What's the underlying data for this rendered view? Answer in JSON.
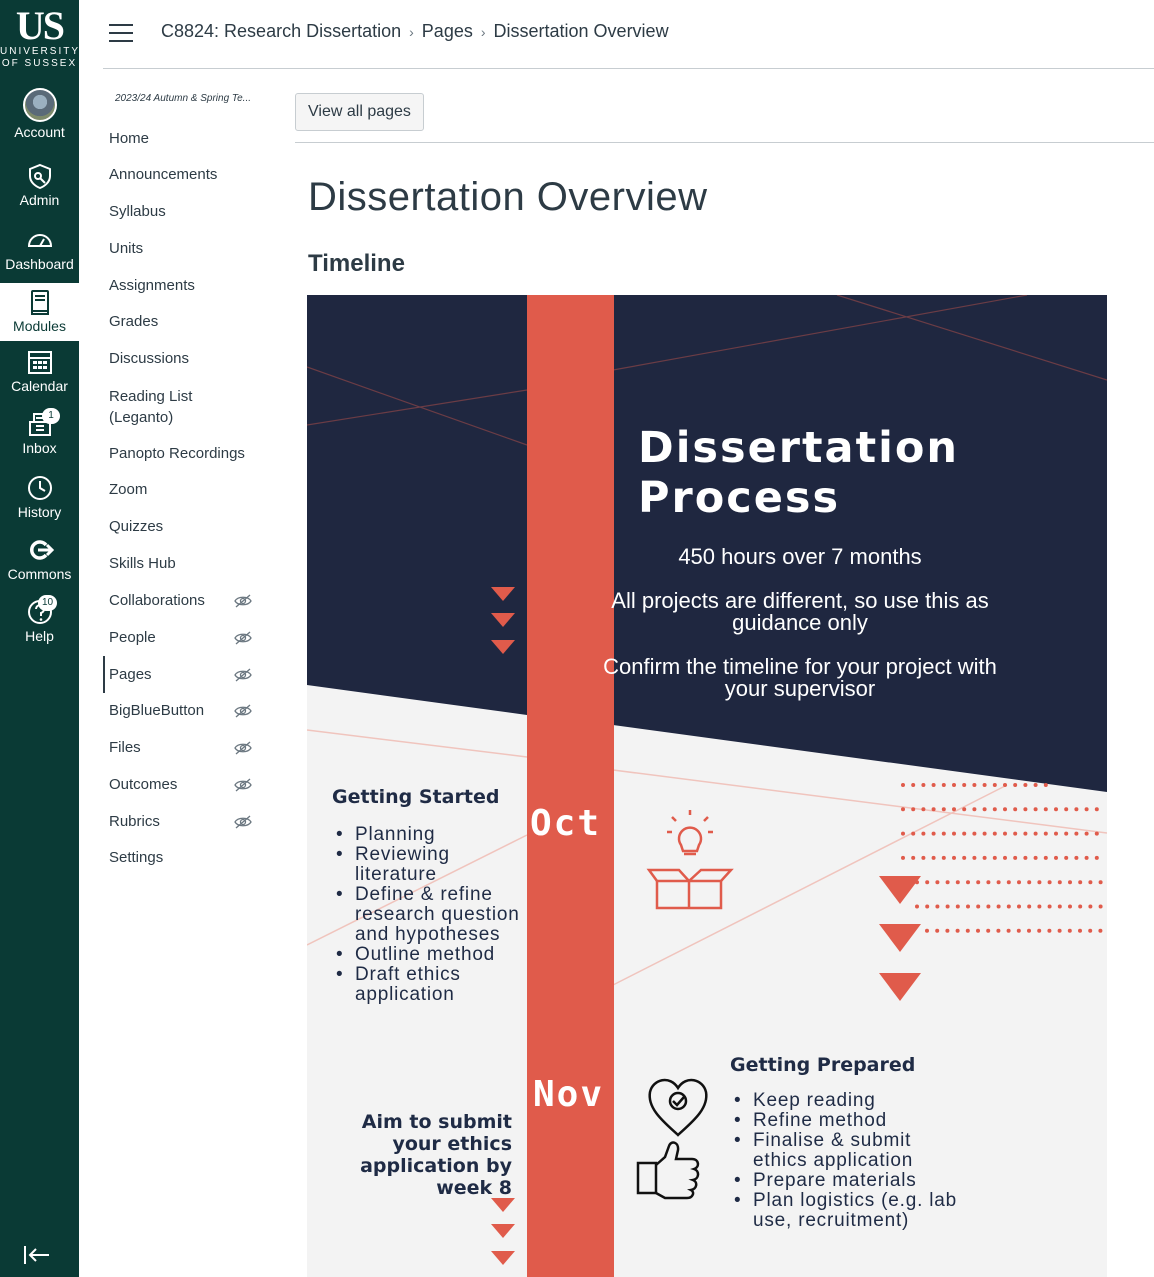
{
  "global_nav": {
    "logo": {
      "line1": "US",
      "line2": "UNIVERSITY",
      "line3": "OF SUSSEX"
    },
    "items": [
      {
        "label": "Account",
        "icon": "avatar"
      },
      {
        "label": "Admin",
        "icon": "shield-icon"
      },
      {
        "label": "Dashboard",
        "icon": "dashboard-icon"
      },
      {
        "label": "Modules",
        "icon": "book-icon"
      },
      {
        "label": "Calendar",
        "icon": "calendar-icon"
      },
      {
        "label": "Inbox",
        "icon": "inbox-icon",
        "badge": "1"
      },
      {
        "label": "History",
        "icon": "clock-icon"
      },
      {
        "label": "Commons",
        "icon": "commons-icon"
      },
      {
        "label": "Help",
        "icon": "help-icon",
        "badge": "10"
      }
    ],
    "collapse_icon": "collapse-nav-icon"
  },
  "header": {
    "breadcrumb": [
      "C8824: Research Dissertation",
      "Pages",
      "Dissertation Overview"
    ]
  },
  "course_nav": {
    "term": "2023/24 Autumn & Spring Te...",
    "items": [
      {
        "label": "Home",
        "hidden": false
      },
      {
        "label": "Announcements",
        "hidden": false
      },
      {
        "label": "Syllabus",
        "hidden": false
      },
      {
        "label": "Units",
        "hidden": false
      },
      {
        "label": "Assignments",
        "hidden": false
      },
      {
        "label": "Grades",
        "hidden": false
      },
      {
        "label": "Discussions",
        "hidden": false
      },
      {
        "label": "Reading List (Leganto)",
        "hidden": false
      },
      {
        "label": "Panopto Recordings",
        "hidden": false
      },
      {
        "label": "Zoom",
        "hidden": false
      },
      {
        "label": "Quizzes",
        "hidden": false
      },
      {
        "label": "Skills Hub",
        "hidden": false
      },
      {
        "label": "Collaborations",
        "hidden": true
      },
      {
        "label": "People",
        "hidden": true
      },
      {
        "label": "Pages",
        "hidden": true,
        "active": true
      },
      {
        "label": "BigBlueButton",
        "hidden": true
      },
      {
        "label": "Files",
        "hidden": true
      },
      {
        "label": "Outcomes",
        "hidden": true
      },
      {
        "label": "Rubrics",
        "hidden": true
      },
      {
        "label": "Settings",
        "hidden": false
      }
    ]
  },
  "content": {
    "view_all_label": "View all pages",
    "page_title": "Dissertation Overview",
    "section_title": "Timeline"
  },
  "infographic": {
    "title_line1": "Dissertation",
    "title_line2": "Process",
    "subtitle1": "450 hours over 7 months",
    "subtitle2": "All projects are different, so use this as guidance only",
    "subtitle3": "Confirm the timeline for your project with your supervisor",
    "month1": "Oct",
    "month2": "Nov",
    "getting_started": {
      "title": "Getting Started",
      "items": [
        "Planning",
        "Reviewing literature",
        "Define & refine research question and hypotheses",
        "Outline method",
        "Draft ethics application"
      ]
    },
    "getting_prepared": {
      "title": "Getting Prepared",
      "items": [
        "Keep reading",
        "Refine method",
        "Finalise & submit ethics application",
        "Prepare materials",
        "Plan logistics (e.g. lab use, recruitment)"
      ]
    },
    "aim_note": "Aim to submit your ethics application by week 8",
    "colors": {
      "navy": "#1f2740",
      "coral": "#e05b4b",
      "light": "#f3f3f3"
    },
    "icons": [
      "lightbulb-box-icon",
      "heart-thumbs-up-icon"
    ]
  }
}
